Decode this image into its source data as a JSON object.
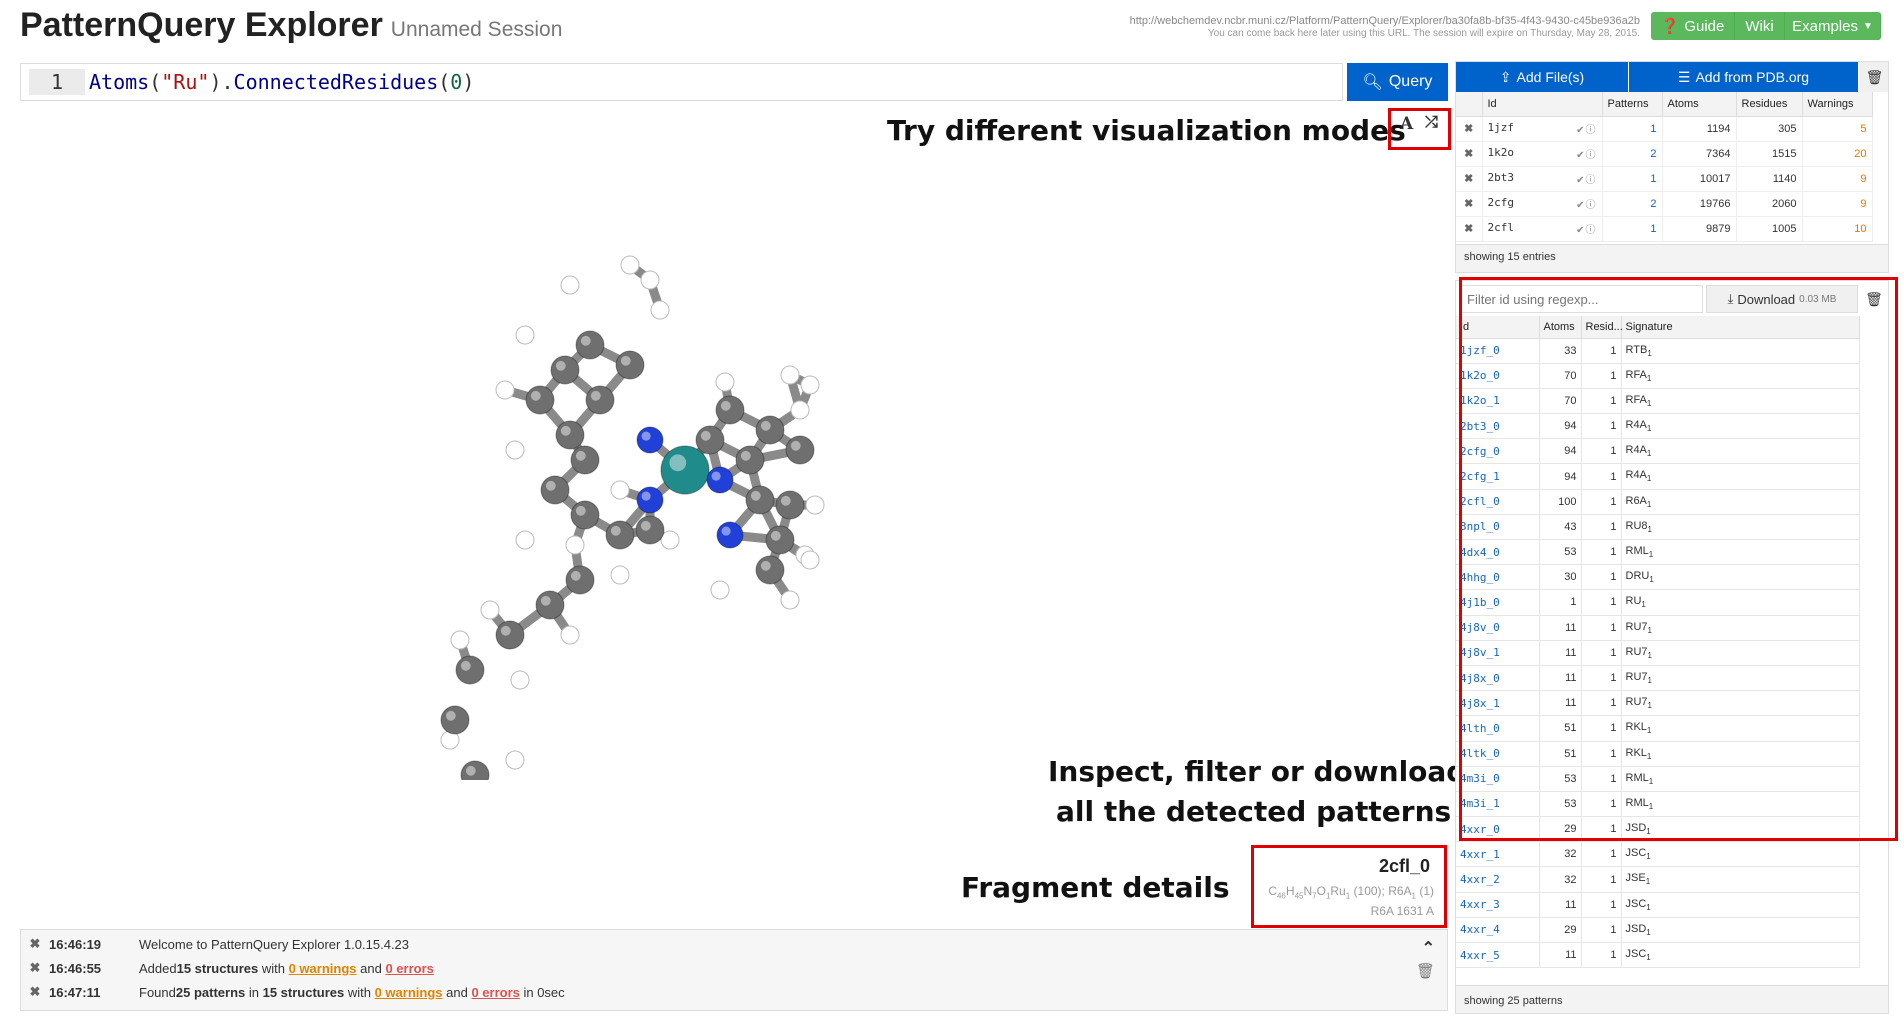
{
  "header": {
    "title": "PatternQuery Explorer",
    "subtitle": "Unnamed Session",
    "session_url": "http://webchemdev.ncbr.muni.cz/Platform/PatternQuery/Explorer/ba30fa8b-bf35-4f43-9430-c45be936a2b",
    "session_note": "You can come back here later using this URL. The session will expire on Thursday, May 28, 2015.",
    "buttons": {
      "guide": "Guide",
      "wiki": "Wiki",
      "examples": "Examples"
    }
  },
  "query": {
    "line_number": "1",
    "tokens": {
      "fn1": "Atoms",
      "p1": "(",
      "str": "\"Ru\"",
      "p2": ").",
      "fn2": "ConnectedResidues",
      "p3": "(",
      "num": "0",
      "p4": ")"
    },
    "button_label": "Query"
  },
  "callouts": {
    "visualization": "Try different visualization modes",
    "inspect_line1": "Inspect, filter or download",
    "inspect_line2": "all the detected patterns",
    "fragment": "Fragment details"
  },
  "visualization": {
    "label_mode_icon": "A",
    "shuffle_icon": "⤮"
  },
  "fragment": {
    "id": "2cfl_0",
    "formula": "C46H45N7O1Ru1 (100); R6A1 (1)",
    "residue": "R6A 1631 A"
  },
  "log": {
    "entries": [
      {
        "time": "16:46:19",
        "text": "Welcome to PatternQuery Explorer 1.0.15.4.23"
      },
      {
        "time": "16:46:55",
        "pre": "Added ",
        "count": "15 structures",
        "mid": " with ",
        "warnings": "0 warnings",
        "and": " and ",
        "errors": "0 errors",
        "post": ""
      },
      {
        "time": "16:47:11",
        "pre": "Found ",
        "count": "25 patterns",
        "mid": " in ",
        "count2": "15 structures",
        "mid2": " with ",
        "warnings": "0 warnings",
        "and": " and ",
        "errors": "0 errors",
        "post": " in 0sec"
      }
    ]
  },
  "structures": {
    "add_file": "Add File(s)",
    "add_pdb": "Add from PDB.org",
    "columns": [
      "Id",
      "Patterns",
      "Atoms",
      "Residues",
      "Warnings"
    ],
    "rows": [
      {
        "id": "1jzf",
        "patterns": "1",
        "atoms": "1194",
        "residues": "305",
        "warnings": "5"
      },
      {
        "id": "1k2o",
        "patterns": "2",
        "atoms": "7364",
        "residues": "1515",
        "warnings": "20"
      },
      {
        "id": "2bt3",
        "patterns": "1",
        "atoms": "10017",
        "residues": "1140",
        "warnings": "9"
      },
      {
        "id": "2cfg",
        "patterns": "2",
        "atoms": "19766",
        "residues": "2060",
        "warnings": "9"
      },
      {
        "id": "2cfl",
        "patterns": "1",
        "atoms": "9879",
        "residues": "1005",
        "warnings": "10"
      }
    ],
    "footer": "showing 15 entries"
  },
  "patterns": {
    "filter_placeholder": "Filter id using regexp...",
    "download_label": "Download",
    "download_size": "0.03 MB",
    "columns": [
      "Id",
      "Atoms",
      "Resid...",
      "Signature"
    ],
    "rows": [
      {
        "id": "1jzf_0",
        "atoms": "33",
        "res": "1",
        "sig": "RTB",
        "sub": "1"
      },
      {
        "id": "1k2o_0",
        "atoms": "70",
        "res": "1",
        "sig": "RFA",
        "sub": "1"
      },
      {
        "id": "1k2o_1",
        "atoms": "70",
        "res": "1",
        "sig": "RFA",
        "sub": "1"
      },
      {
        "id": "2bt3_0",
        "atoms": "94",
        "res": "1",
        "sig": "R4A",
        "sub": "1"
      },
      {
        "id": "2cfg_0",
        "atoms": "94",
        "res": "1",
        "sig": "R4A",
        "sub": "1"
      },
      {
        "id": "2cfg_1",
        "atoms": "94",
        "res": "1",
        "sig": "R4A",
        "sub": "1"
      },
      {
        "id": "2cfl_0",
        "atoms": "100",
        "res": "1",
        "sig": "R6A",
        "sub": "1"
      },
      {
        "id": "3npl_0",
        "atoms": "43",
        "res": "1",
        "sig": "RU8",
        "sub": "1"
      },
      {
        "id": "4dx4_0",
        "atoms": "53",
        "res": "1",
        "sig": "RML",
        "sub": "1"
      },
      {
        "id": "4hhg_0",
        "atoms": "30",
        "res": "1",
        "sig": "DRU",
        "sub": "1"
      },
      {
        "id": "4j1b_0",
        "atoms": "1",
        "res": "1",
        "sig": "RU",
        "sub": "1"
      },
      {
        "id": "4j8v_0",
        "atoms": "11",
        "res": "1",
        "sig": "RU7",
        "sub": "1"
      },
      {
        "id": "4j8v_1",
        "atoms": "11",
        "res": "1",
        "sig": "RU7",
        "sub": "1"
      },
      {
        "id": "4j8x_0",
        "atoms": "11",
        "res": "1",
        "sig": "RU7",
        "sub": "1"
      },
      {
        "id": "4j8x_1",
        "atoms": "11",
        "res": "1",
        "sig": "RU7",
        "sub": "1"
      },
      {
        "id": "4lth_0",
        "atoms": "51",
        "res": "1",
        "sig": "RKL",
        "sub": "1"
      },
      {
        "id": "4ltk_0",
        "atoms": "51",
        "res": "1",
        "sig": "RKL",
        "sub": "1"
      },
      {
        "id": "4m3i_0",
        "atoms": "53",
        "res": "1",
        "sig": "RML",
        "sub": "1"
      },
      {
        "id": "4m3i_1",
        "atoms": "53",
        "res": "1",
        "sig": "RML",
        "sub": "1"
      },
      {
        "id": "4xxr_0",
        "atoms": "29",
        "res": "1",
        "sig": "JSD",
        "sub": "1"
      },
      {
        "id": "4xxr_1",
        "atoms": "32",
        "res": "1",
        "sig": "JSC",
        "sub": "1"
      },
      {
        "id": "4xxr_2",
        "atoms": "32",
        "res": "1",
        "sig": "JSE",
        "sub": "1"
      },
      {
        "id": "4xxr_3",
        "atoms": "11",
        "res": "1",
        "sig": "JSC",
        "sub": "1"
      },
      {
        "id": "4xxr_4",
        "atoms": "29",
        "res": "1",
        "sig": "JSD",
        "sub": "1"
      },
      {
        "id": "4xxr_5",
        "atoms": "11",
        "res": "1",
        "sig": "JSC",
        "sub": "1"
      }
    ],
    "footer": "showing 25 patterns"
  },
  "colors": {
    "primary": "#0063cc",
    "success": "#5cb85c",
    "highlight": "#e00000",
    "warning": "#e08400",
    "error": "#d9534f",
    "carbon": "#6f6f6f",
    "nitrogen": "#2040d8",
    "oxygen": "#e00000",
    "ruthenium": "#1f8b8b",
    "hydrogen": "#ffffff"
  }
}
